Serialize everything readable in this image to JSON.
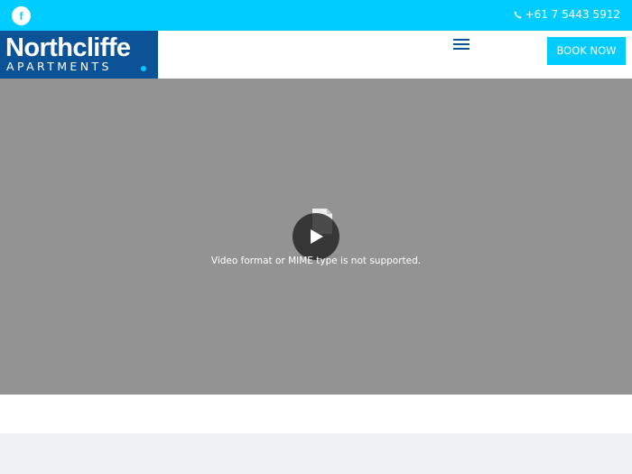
{
  "topbar": {
    "facebook_icon_letter": "f",
    "phone_icon": "phone-icon",
    "phone": "+61 7 5443 5912"
  },
  "header": {
    "logo": {
      "main": "Northcliffe",
      "sub": "APARTMENTS"
    },
    "menu_icon": "hamburger-menu-icon",
    "book_label": "BOOK NOW"
  },
  "video": {
    "message": "Video format or MIME type is not supported.",
    "play_icon": "play-icon",
    "file_icon": "document-icon"
  },
  "colors": {
    "accent": "#00ccff",
    "brand": "#0b5296",
    "video_bg": "#939393",
    "footer_bg": "#eef0f2"
  }
}
